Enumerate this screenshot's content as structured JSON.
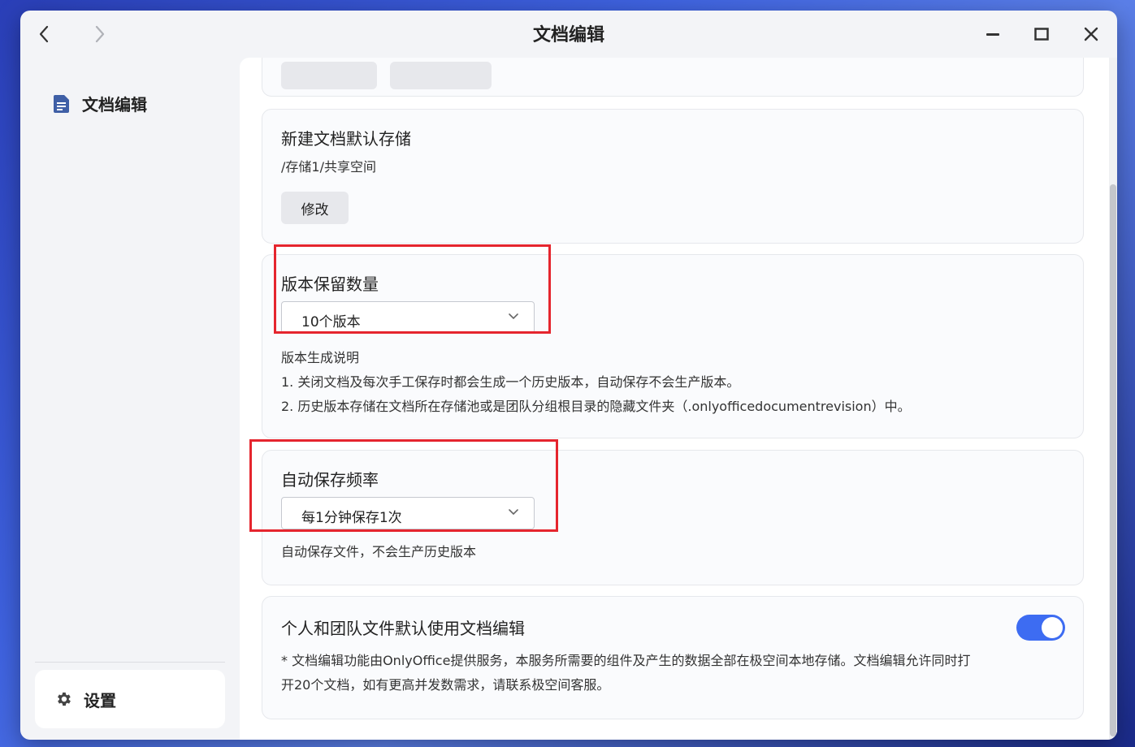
{
  "window": {
    "title": "文档编辑"
  },
  "sidebar": {
    "items": [
      {
        "label": "文档编辑",
        "icon": "document-icon"
      }
    ],
    "settings": {
      "label": "设置",
      "icon": "gear-icon"
    }
  },
  "cards": {
    "top_partial": {
      "buttons": [
        "",
        ""
      ]
    },
    "storage": {
      "title": "新建文档默认存储",
      "path": "/存储1/共享空间",
      "modify_label": "修改"
    },
    "versions": {
      "title": "版本保留数量",
      "selected": "10个版本",
      "desc_title": "版本生成说明",
      "desc_1": "1. 关闭文档及每次手工保存时都会生成一个历史版本，自动保存不会生产版本。",
      "desc_2": "2. 历史版本存储在文档所在存储池或是团队分组根目录的隐藏文件夹（.onlyofficedocumentrevision）中。"
    },
    "autosave": {
      "title": "自动保存频率",
      "selected": "每1分钟保存1次",
      "note": "自动保存文件，不会生产历史版本"
    },
    "default_use": {
      "title": "个人和团队文件默认使用文档编辑",
      "enabled": true,
      "note_1": "* 文档编辑功能由OnlyOffice提供服务，本服务所需要的组件及产生的数据全部在极空间本地存储。文档编辑允许同时打",
      "note_2": "开20个文档，如有更高并发数需求，请联系极空间客服。"
    }
  },
  "colors": {
    "accent": "#3d6cf2",
    "highlight": "#e5252e"
  }
}
